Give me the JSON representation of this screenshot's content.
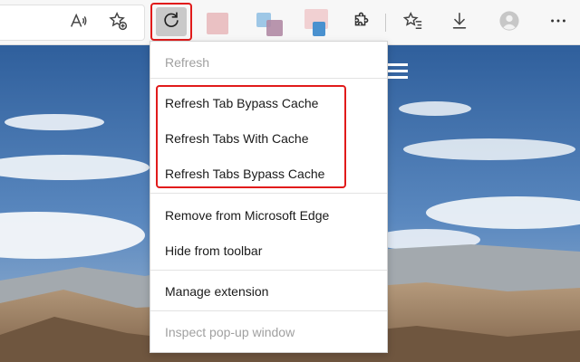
{
  "toolbar": {
    "buttons": [
      {
        "name": "read-aloud",
        "icon": "read-aloud-icon"
      },
      {
        "name": "add-favorite",
        "icon": "star-plus-icon"
      },
      {
        "name": "refresh-extension",
        "icon": "refresh-icon"
      },
      {
        "name": "extensions",
        "icon": "puzzle-icon"
      },
      {
        "name": "favorites",
        "icon": "favorites-star-icon"
      },
      {
        "name": "downloads",
        "icon": "download-icon"
      },
      {
        "name": "profile",
        "icon": "avatar-icon"
      },
      {
        "name": "more",
        "icon": "ellipsis-icon"
      }
    ],
    "accent_highlight": "#e11b1b"
  },
  "menu": {
    "header": "Refresh",
    "items": [
      {
        "label": "Refresh Tab Bypass Cache"
      },
      {
        "label": "Refresh Tabs With Cache"
      },
      {
        "label": "Refresh Tabs Bypass Cache"
      },
      {
        "label": "Remove from Microsoft Edge"
      },
      {
        "label": "Hide from toolbar"
      },
      {
        "label": "Manage extension"
      },
      {
        "label": "Inspect pop-up window"
      }
    ]
  }
}
